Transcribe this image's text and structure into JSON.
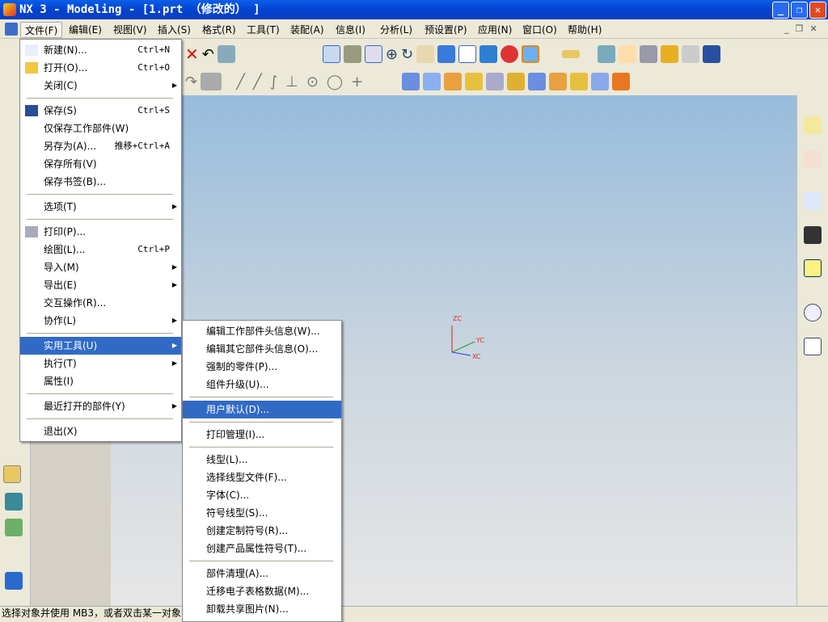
{
  "window": {
    "title": "NX 3 - Modeling - [1.prt （修改的） ]"
  },
  "menubar": {
    "items": [
      "文件(F)",
      "编辑(E)",
      "视图(V)",
      "插入(S)",
      "格式(R)",
      "工具(T)",
      "装配(A)",
      "信息(I)",
      "分析(L)",
      "预设置(P)",
      "应用(N)",
      "窗口(O)",
      "帮助(H)"
    ]
  },
  "file_menu": {
    "items": [
      {
        "label": "新建(N)...",
        "shortcut": "Ctrl+N",
        "icon": "new-file-icon"
      },
      {
        "label": "打开(O)...",
        "shortcut": "Ctrl+O",
        "icon": "open-folder-icon"
      },
      {
        "label": "关闭(C)",
        "submenu": true
      },
      {
        "sep": true
      },
      {
        "label": "保存(S)",
        "shortcut": "Ctrl+S",
        "icon": "save-icon"
      },
      {
        "label": "仅保存工作部件(W)"
      },
      {
        "label": "另存为(A)...",
        "shortcut": "推移+Ctrl+A"
      },
      {
        "label": "保存所有(V)"
      },
      {
        "label": "保存书签(B)..."
      },
      {
        "sep": true
      },
      {
        "label": "选项(T)",
        "submenu": true
      },
      {
        "sep": true
      },
      {
        "label": "打印(P)...",
        "icon": "printer-icon"
      },
      {
        "label": "绘图(L)...",
        "shortcut": "Ctrl+P"
      },
      {
        "label": "导入(M)",
        "submenu": true
      },
      {
        "label": "导出(E)",
        "submenu": true
      },
      {
        "label": "交互操作(R)..."
      },
      {
        "label": "协作(L)",
        "submenu": true
      },
      {
        "sep": true
      },
      {
        "label": "实用工具(U)",
        "submenu": true,
        "highlighted": true
      },
      {
        "label": "执行(T)",
        "submenu": true
      },
      {
        "label": "属性(I)"
      },
      {
        "sep": true
      },
      {
        "label": "最近打开的部件(Y)",
        "submenu": true
      },
      {
        "sep": true
      },
      {
        "label": "退出(X)"
      }
    ]
  },
  "utilities_menu": {
    "items": [
      {
        "label": "编辑工作部件头信息(W)..."
      },
      {
        "label": "编辑其它部件头信息(O)..."
      },
      {
        "label": "强制的零件(P)..."
      },
      {
        "label": "组件升级(U)..."
      },
      {
        "sep": true
      },
      {
        "label": "用户默认(D)...",
        "highlighted": true
      },
      {
        "sep": true
      },
      {
        "label": "打印管理(I)..."
      },
      {
        "sep": true
      },
      {
        "label": "线型(L)..."
      },
      {
        "label": "选择线型文件(F)..."
      },
      {
        "label": "字体(C)..."
      },
      {
        "label": "符号线型(S)..."
      },
      {
        "label": "创建定制符号(R)..."
      },
      {
        "label": "创建产品属性符号(T)..."
      },
      {
        "sep": true
      },
      {
        "label": "部件清理(A)..."
      },
      {
        "label": "迁移电子表格数据(M)..."
      },
      {
        "label": "卸载共享图片(N)..."
      }
    ]
  },
  "triad": {
    "zc": "ZC",
    "yc": "YC",
    "xc": "XC"
  },
  "statusbar": {
    "text": "选择对象并使用 MB3，或者双击某一对象"
  },
  "colors": {
    "title": "#0343d0",
    "highlight": "#316ac5",
    "viewport_top": "#98bcdc",
    "viewport_bottom": "#e6e6e6"
  }
}
